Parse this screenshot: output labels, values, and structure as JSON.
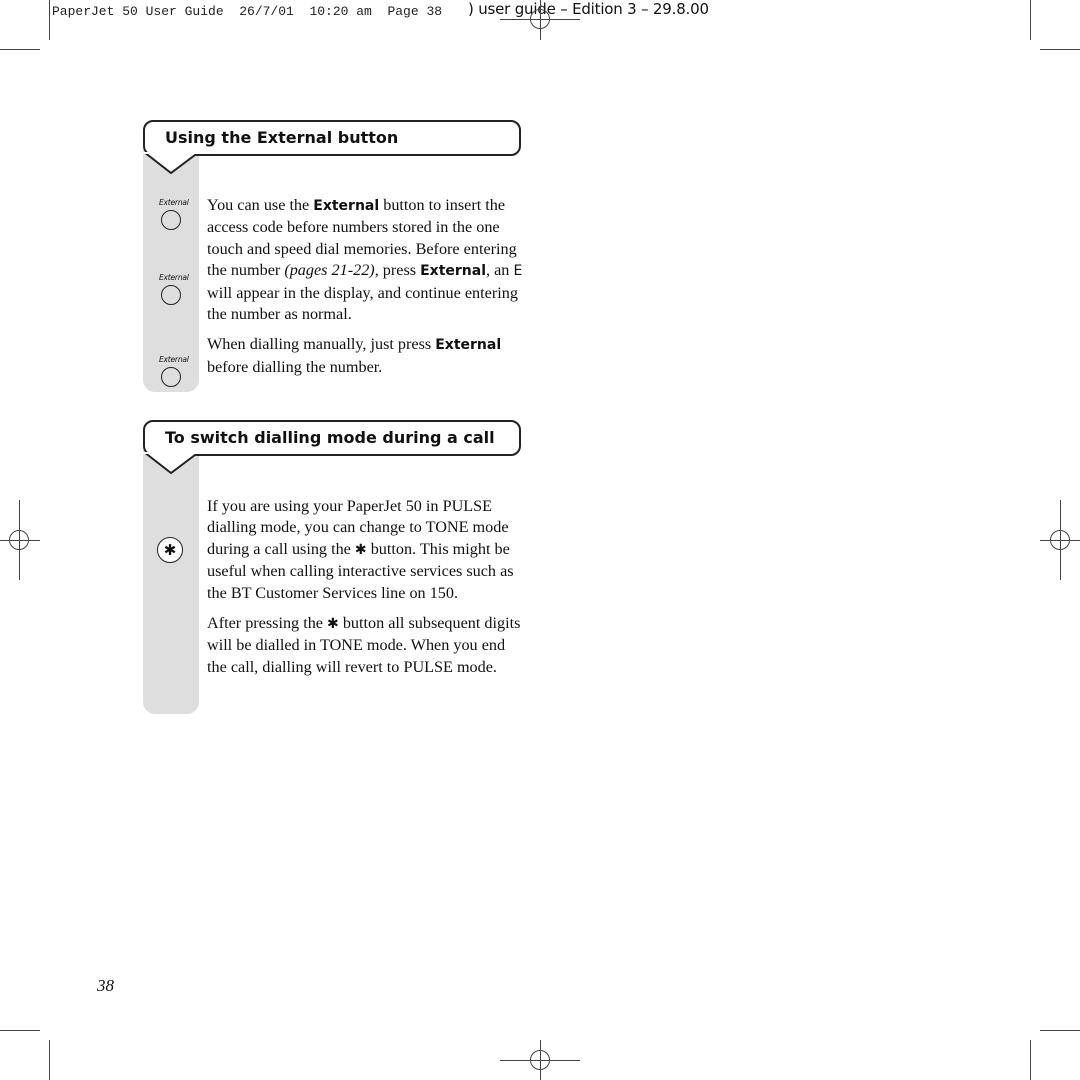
{
  "slug": {
    "text": "PaperJet 50 User Guide  26/7/01  10:20 am  Page 38",
    "tail": ") user guide – Edition 3 – 29.8.00"
  },
  "sections": [
    {
      "heading": "Using the External button",
      "button_label": "External",
      "paragraphs": {
        "p1": {
          "t1": "You can use the ",
          "b1": "External",
          "t2": " button to insert the access code before numbers stored in the one touch and speed dial memories. Before entering the number ",
          "ref": "(pages 21-22)",
          "t3": ", press ",
          "b2": "External",
          "t4": ", an ",
          "code": "E",
          "t5": " will appear in the display, and continue entering the number as normal."
        },
        "p2": {
          "t1": "When dialling manually, just press ",
          "b1": "External",
          "t2": " before dialling the number."
        }
      }
    },
    {
      "heading": "To switch dialling mode during a call",
      "button_glyph": "✱",
      "paragraphs": {
        "p1": {
          "t1": "If you are using your PaperJet 50 in PULSE dialling mode, you can change to TONE mode during a call using the ",
          "glyph": "✱",
          "t2": " button. This might be useful when calling interactive services such as the BT Customer Services line on 150."
        },
        "p2": {
          "t1": "After pressing the ",
          "glyph": "✱",
          "t2": " button all subsequent digits will be dialled in TONE mode. When you end the call, dialling will revert to PULSE mode."
        }
      }
    }
  ],
  "page_number": "38"
}
